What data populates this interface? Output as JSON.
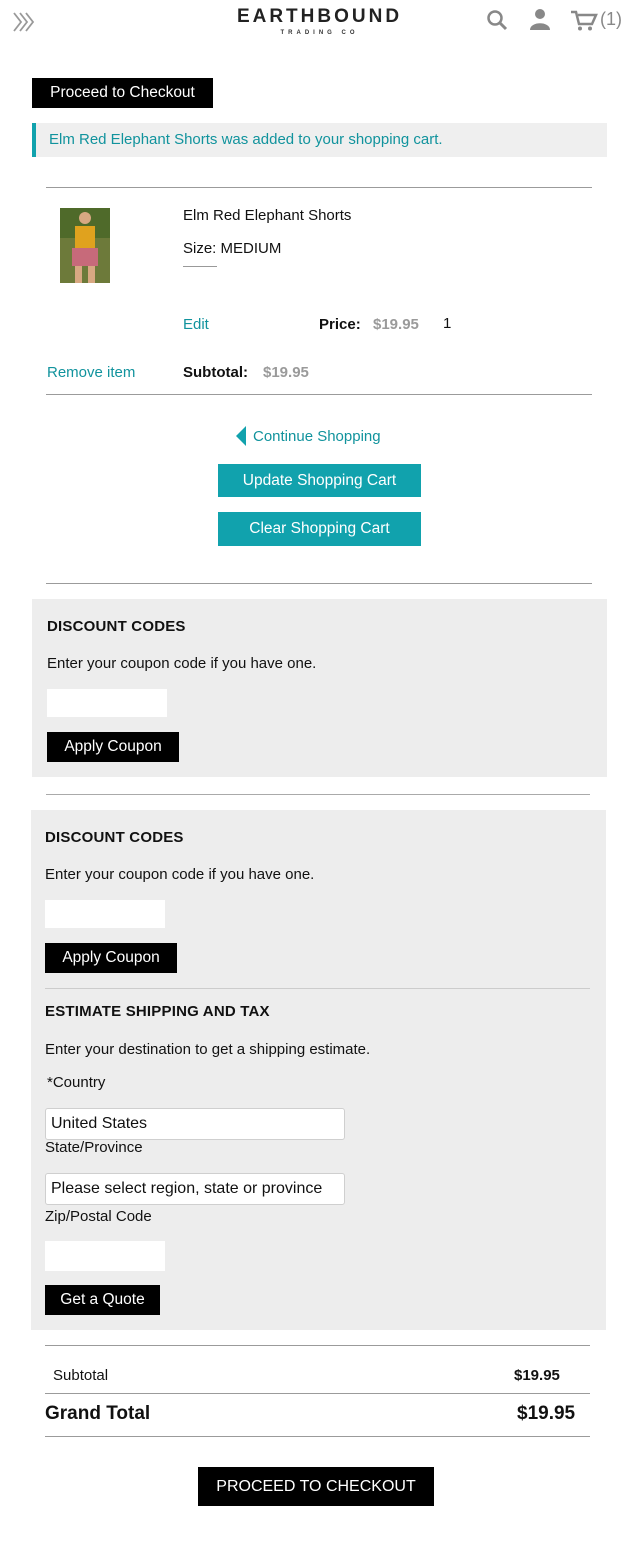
{
  "header": {
    "logo_main": "EARTHBOUND",
    "logo_sub": "TRADING CO",
    "cart_count": "(1)"
  },
  "top_checkout_label": "Proceed to Checkout",
  "notice": "Elm Red Elephant Shorts was added to your shopping cart.",
  "cart_item": {
    "name": "Elm Red Elephant Shorts",
    "size": "Size: MEDIUM",
    "edit_label": "Edit",
    "price_label": "Price:",
    "price": "$19.95",
    "qty": "1",
    "remove_label": "Remove item",
    "subtotal_label": "Subtotal:",
    "subtotal": "$19.95"
  },
  "actions": {
    "continue": "Continue Shopping",
    "update": "Update Shopping Cart",
    "clear": "Clear Shopping Cart"
  },
  "discount1": {
    "title": "DISCOUNT CODES",
    "desc": "Enter your coupon code if you have one.",
    "button": "Apply Coupon"
  },
  "discount2": {
    "title": "DISCOUNT CODES",
    "desc": "Enter your coupon code if you have one.",
    "button": "Apply Coupon"
  },
  "shipping": {
    "title": "ESTIMATE SHIPPING AND TAX",
    "desc": "Enter your destination to get a shipping estimate.",
    "country_label": "*Country",
    "country_value": "United States",
    "state_label": "State/Province",
    "state_value": "Please select region, state or province",
    "zip_label": "Zip/Postal Code",
    "quote_button": "Get a Quote"
  },
  "totals": {
    "subtotal_label": "Subtotal",
    "subtotal_value": "$19.95",
    "grand_label": "Grand Total",
    "grand_value": "$19.95"
  },
  "bottom_checkout_label": "PROCEED TO CHECKOUT",
  "colors": {
    "accent": "#11a2ad",
    "panel": "#ededed",
    "button": "#000000"
  }
}
